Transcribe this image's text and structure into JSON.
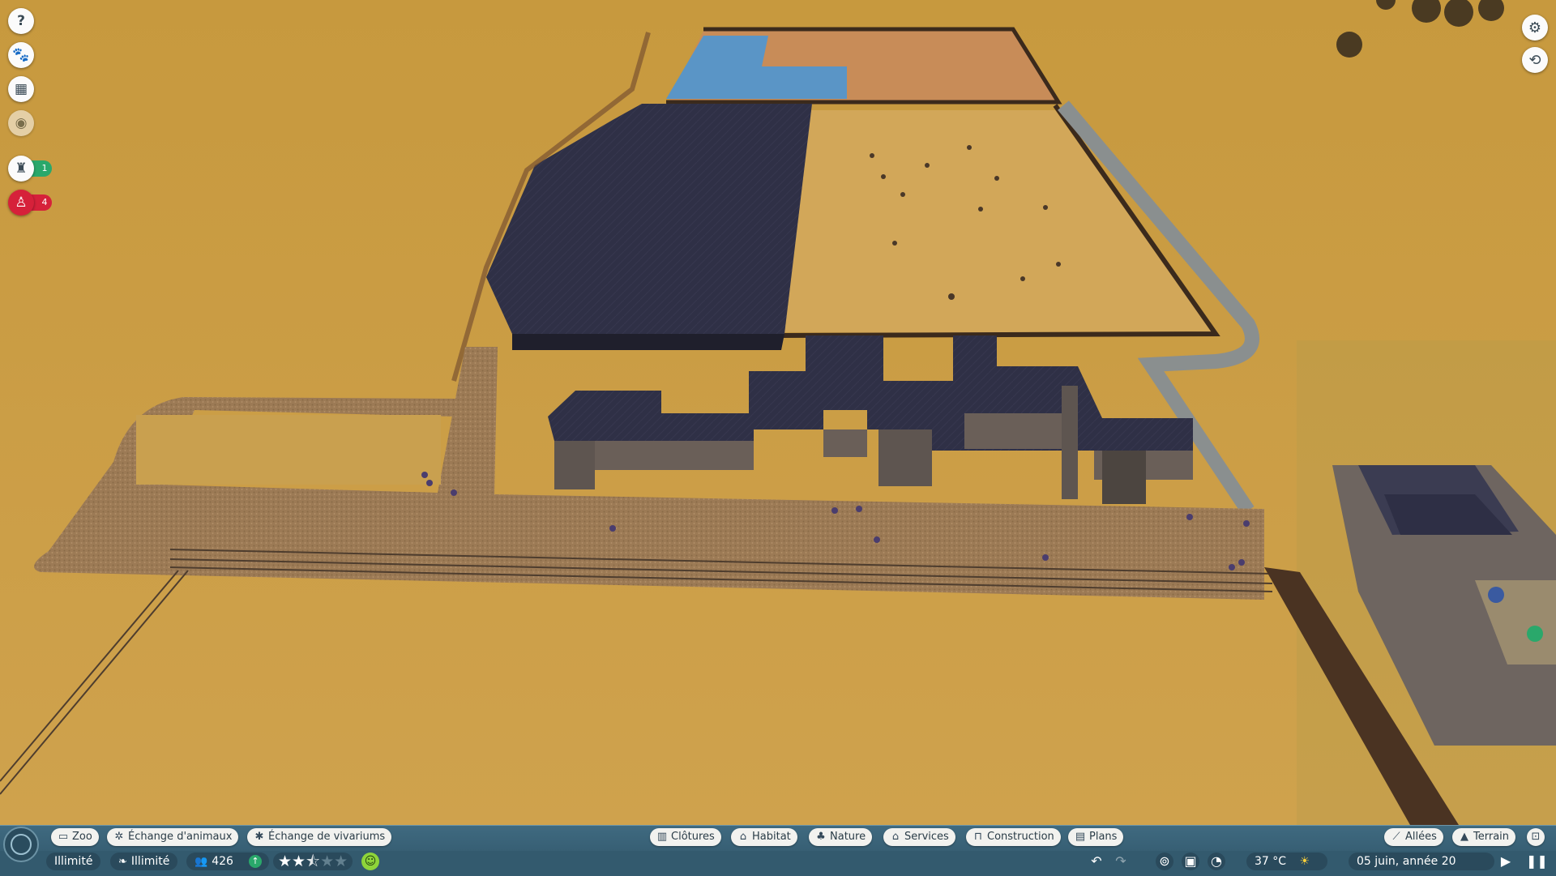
{
  "left_toolbar": {
    "items": [
      {
        "name": "help",
        "icon": "question-mark-icon"
      },
      {
        "name": "animals",
        "icon": "paw-icon"
      },
      {
        "name": "calendar",
        "icon": "calendar-icon"
      },
      {
        "name": "visibility",
        "icon": "eye-icon"
      }
    ],
    "staff_count": "1",
    "guest_alert_count": "4",
    "staff_color": "#2aa86b",
    "alert_color": "#d6213a"
  },
  "right_toolbar": {
    "items": [
      {
        "name": "settings",
        "icon": "gear-icon"
      },
      {
        "name": "camera",
        "icon": "camera-icon"
      }
    ]
  },
  "bottom_tabs": {
    "left": [
      {
        "label": "Zoo",
        "icon": "zoo-sign-icon"
      },
      {
        "label": "Échange d'animaux",
        "icon": "paw-icon"
      },
      {
        "label": "Échange de vivariums",
        "icon": "bug-icon"
      }
    ],
    "center": [
      {
        "label": "Clôtures",
        "icon": "fence-icon"
      },
      {
        "label": "Habitat",
        "icon": "habitat-icon"
      },
      {
        "label": "Nature",
        "icon": "tree-icon"
      },
      {
        "label": "Services",
        "icon": "shop-icon"
      },
      {
        "label": "Construction",
        "icon": "construction-icon"
      },
      {
        "label": "Plans",
        "icon": "blueprint-icon"
      }
    ],
    "right": [
      {
        "label": "Allées",
        "icon": "path-icon"
      },
      {
        "label": "Terrain",
        "icon": "mountain-icon"
      }
    ]
  },
  "status_bar": {
    "money": "Illimité",
    "research": "Illimité",
    "guests": "426",
    "guest_trend": "up",
    "rating_stars": 2.5,
    "rating_max": 5,
    "mood": "happy",
    "temperature": "37 °C",
    "weather": "sunny",
    "date": "05 juin, année 20"
  },
  "colors": {
    "ground": "#c99a45",
    "path": "#9d7c57",
    "water": "#5a95c6",
    "roof": "#2e2f45",
    "bar": "#335a6e",
    "tab_bg": "#f2f2ef"
  }
}
